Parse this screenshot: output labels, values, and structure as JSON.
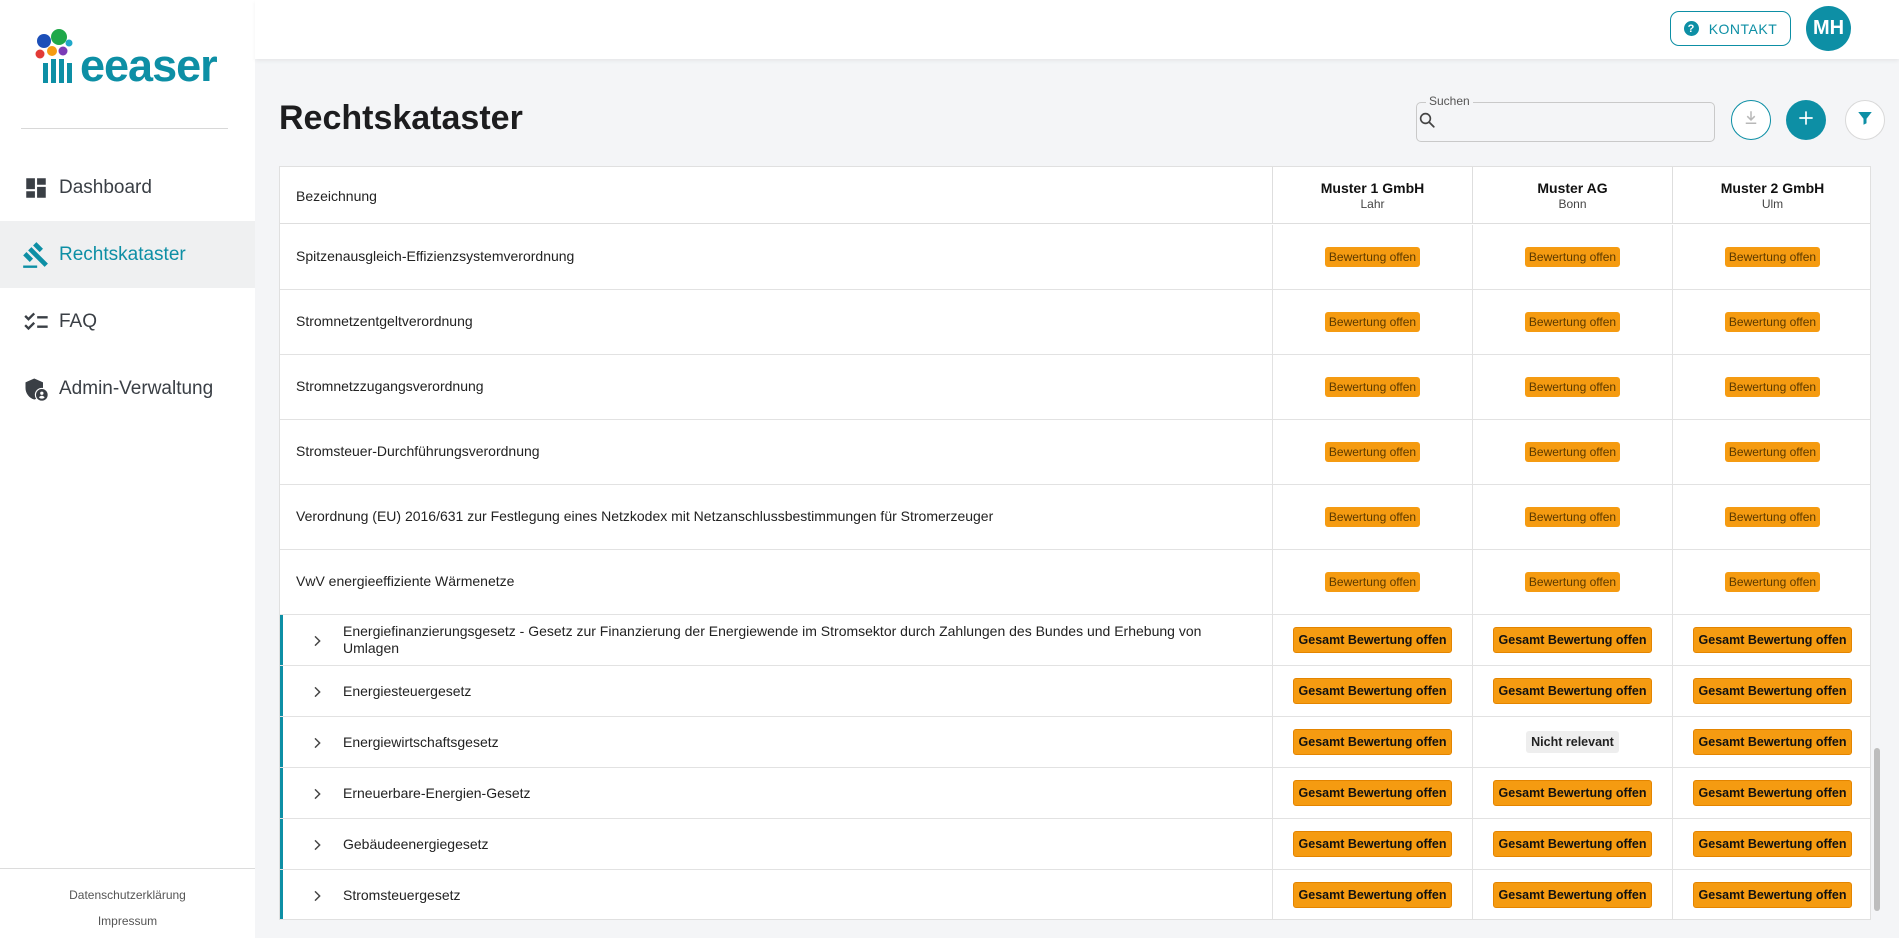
{
  "brand": {
    "name": "eeaser",
    "color": "#0d8fa5"
  },
  "nav": [
    {
      "label": "Dashboard",
      "icon": "dashboard-icon",
      "active": false
    },
    {
      "label": "Rechtskataster",
      "icon": "gavel-icon",
      "active": true
    },
    {
      "label": "FAQ",
      "icon": "checklist-icon",
      "active": false
    },
    {
      "label": "Admin-Verwaltung",
      "icon": "admin-shield-icon",
      "active": false
    }
  ],
  "footer": {
    "privacy": "Datenschutzerklärung",
    "imprint": "Impressum"
  },
  "topbar": {
    "contact_label": "KONTAKT",
    "avatar_initials": "MH"
  },
  "page": {
    "title": "Rechtskataster"
  },
  "search": {
    "label": "Suchen",
    "value": "",
    "placeholder": ""
  },
  "table": {
    "name_header": "Bezeichnung",
    "columns": [
      {
        "name": "Muster 1 GmbH",
        "city": "Lahr"
      },
      {
        "name": "Muster AG",
        "city": "Bonn"
      },
      {
        "name": "Muster 2 GmbH",
        "city": "Ulm"
      }
    ],
    "rows": [
      {
        "name": "Spitzenausgleich-Effizienzsystemverordnung",
        "values": [
          "Bewertung offen",
          "Bewertung offen",
          "Bewertung offen"
        ]
      },
      {
        "name": "Stromnetzentgeltverordnung",
        "values": [
          "Bewertung offen",
          "Bewertung offen",
          "Bewertung offen"
        ]
      },
      {
        "name": "Stromnetzzugangsverordnung",
        "values": [
          "Bewertung offen",
          "Bewertung offen",
          "Bewertung offen"
        ]
      },
      {
        "name": "Stromsteuer-Durchführungsverordnung",
        "values": [
          "Bewertung offen",
          "Bewertung offen",
          "Bewertung offen"
        ]
      },
      {
        "name": "Verordnung (EU) 2016/631 zur Festlegung eines Netzkodex mit Netzanschlussbestimmungen für Stromerzeuger",
        "values": [
          "Bewertung offen",
          "Bewertung offen",
          "Bewertung offen"
        ]
      },
      {
        "name": "VwV energieeffiziente Wärmenetze",
        "values": [
          "Bewertung offen",
          "Bewertung offen",
          "Bewertung offen"
        ]
      }
    ],
    "groups": [
      {
        "name": "Energiefinanzierungsgesetz - Gesetz zur Finanzierung der Energiewende im Stromsektor durch Zahlungen des Bundes und Erhebung von Umlagen",
        "values": [
          "Gesamt Bewertung offen",
          "Gesamt Bewertung offen",
          "Gesamt Bewertung offen"
        ]
      },
      {
        "name": "Energiesteuergesetz",
        "values": [
          "Gesamt Bewertung offen",
          "Gesamt Bewertung offen",
          "Gesamt Bewertung offen"
        ]
      },
      {
        "name": "Energiewirtschaftsgesetz",
        "values": [
          "Gesamt Bewertung offen",
          "Nicht relevant",
          "Gesamt Bewertung offen"
        ]
      },
      {
        "name": "Erneuerbare-Energien-Gesetz",
        "values": [
          "Gesamt Bewertung offen",
          "Gesamt Bewertung offen",
          "Gesamt Bewertung offen"
        ]
      },
      {
        "name": "Gebäudeenergiegesetz",
        "values": [
          "Gesamt Bewertung offen",
          "Gesamt Bewertung offen",
          "Gesamt Bewertung offen"
        ]
      },
      {
        "name": "Stromsteuergesetz",
        "values": [
          "Gesamt Bewertung offen",
          "Gesamt Bewertung offen",
          "Gesamt Bewertung offen"
        ]
      }
    ]
  },
  "colors": {
    "accent": "#0d8fa5",
    "status_open": "#f59b11",
    "status_irrelevant": "#eeeeee"
  }
}
